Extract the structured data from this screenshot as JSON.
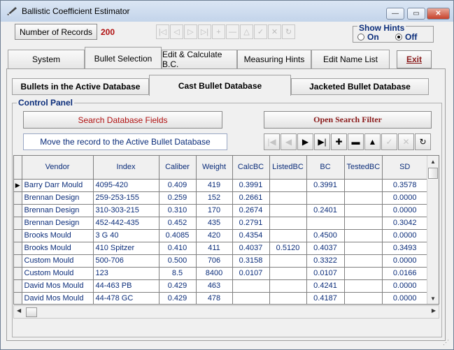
{
  "window": {
    "title": "Ballistic Coefficient Estimator",
    "min": "—",
    "max": "▭",
    "close": "✕"
  },
  "toolbar": {
    "records_label": "Number of Records",
    "records_count": "200"
  },
  "hints": {
    "title": "Show Hints",
    "on_label": "On",
    "off_label": "Off",
    "selected": "Off"
  },
  "main_tabs": [
    {
      "label": "System"
    },
    {
      "label": "Bullet Selection",
      "active": true
    },
    {
      "label": "Edit & Calculate B.C."
    },
    {
      "label": "Measuring Hints"
    },
    {
      "label": "Edit Name List"
    }
  ],
  "exit_label": "Exit",
  "sub_tabs": [
    {
      "label": "Bullets in the Active Database"
    },
    {
      "label": "Cast Bullet Database",
      "active": true
    },
    {
      "label": "Jacketed Bullet Database"
    }
  ],
  "control_panel": {
    "title": "Control Panel",
    "search_label": "Search Database Fields",
    "open_filter_label": "Open Search Filter",
    "move_label": "Move the record to the Active Bullet Database"
  },
  "grid": {
    "columns": [
      "Vendor",
      "Index",
      "Caliber",
      "Weight",
      "CalcBC",
      "ListedBC",
      "BC",
      "TestedBC",
      "SD"
    ],
    "rows": [
      [
        "Barry Darr Mould",
        "4095-420",
        "0.409",
        "419",
        "0.3991",
        "",
        "0.3991",
        "",
        "0.3578"
      ],
      [
        "Brennan Design",
        "259-253-155",
        "0.259",
        "152",
        "0.2661",
        "",
        "",
        "",
        "0.0000"
      ],
      [
        "Brennan Design",
        "310-303-215",
        "0.310",
        "170",
        "0.2674",
        "",
        "0.2401",
        "",
        "0.0000"
      ],
      [
        "Brennan Design",
        "452-442-435",
        "0.452",
        "435",
        "0.2791",
        "",
        "",
        "",
        "0.3042"
      ],
      [
        "Brooks Mould",
        "3 G 40",
        "0.4085",
        "420",
        "0.4354",
        "",
        "0.4500",
        "",
        "0.0000"
      ],
      [
        "Brooks Mould",
        "410 Spitzer",
        "0.410",
        "411",
        "0.4037",
        "0.5120",
        "0.4037",
        "",
        "0.3493"
      ],
      [
        "Custom Mould",
        "500-706",
        "0.500",
        "706",
        "0.3158",
        "",
        "0.3322",
        "",
        "0.0000"
      ],
      [
        "Custom Mould",
        "123",
        "8.5",
        "8400",
        "0.0107",
        "",
        "0.0107",
        "",
        "0.0166"
      ],
      [
        "David Mos Mould",
        "44-463 PB",
        "0.429",
        "463",
        "",
        "",
        "0.4241",
        "",
        "0.0000"
      ],
      [
        "David Mos Mould",
        "44-478 GC",
        "0.429",
        "478",
        "",
        "",
        "0.4187",
        "",
        "0.0000"
      ]
    ]
  }
}
